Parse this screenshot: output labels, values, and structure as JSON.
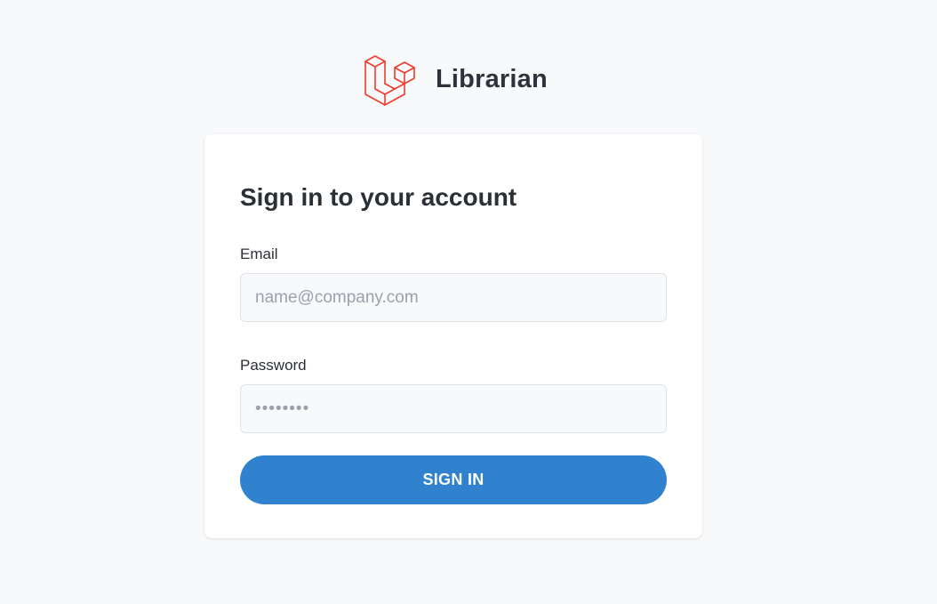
{
  "brand": {
    "name": "Librarian",
    "logo_icon": "laravel-logo-icon",
    "logo_color": "#ef3b2d"
  },
  "login": {
    "title": "Sign in to your account",
    "email_label": "Email",
    "email_value": "",
    "email_placeholder": "name@company.com",
    "password_label": "Password",
    "password_value": "",
    "password_placeholder": "••••••••",
    "submit_label": "SIGN IN"
  },
  "colors": {
    "background": "#f8f9fb",
    "card": "#ffffff",
    "accent": "#3182ce",
    "input_background": "#f8f9fb",
    "input_border": "#dfe3e8"
  }
}
